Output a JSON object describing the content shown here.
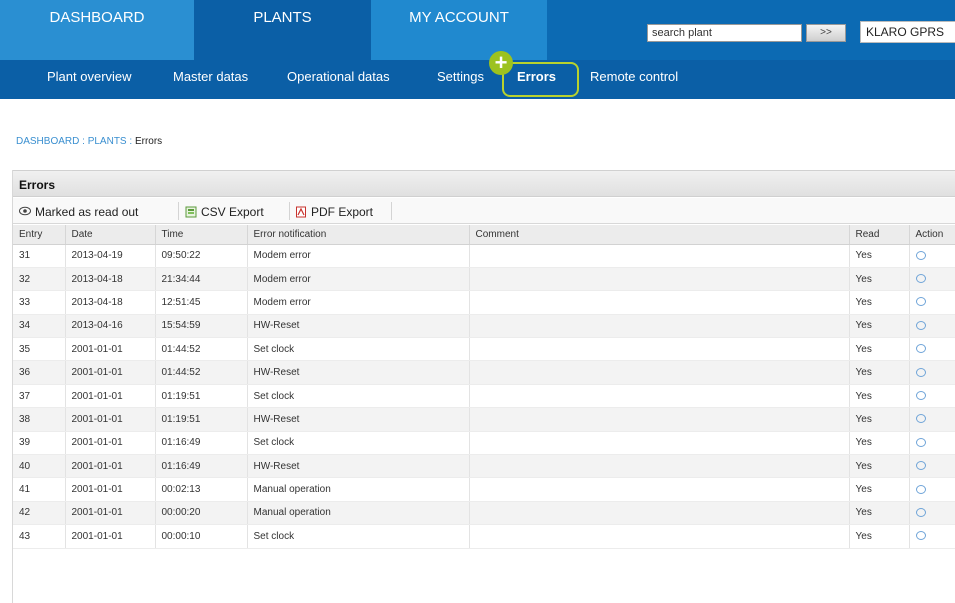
{
  "topnav": {
    "dashboard": "DASHBOARD",
    "plants": "PLANTS",
    "my_account": "MY ACCOUNT",
    "search_value": "search plant",
    "search_button": ">>",
    "account_name": "KLARO GPRS"
  },
  "subnav": {
    "plant_overview": "Plant overview",
    "master_datas": "Master datas",
    "operational_datas": "Operational datas",
    "settings": "Settings",
    "errors": "Errors",
    "remote_control": "Remote control",
    "plus": "+"
  },
  "breadcrumb": {
    "dashboard": "DASHBOARD",
    "plants": "PLANTS",
    "separator": ":",
    "current": "Errors"
  },
  "panel": {
    "title": "Errors",
    "toolbar": {
      "marked_read": "Marked as read out",
      "csv_export": "CSV Export",
      "pdf_export": "PDF Export"
    }
  },
  "table": {
    "headers": {
      "entry": "Entry",
      "date": "Date",
      "time": "Time",
      "notification": "Error notification",
      "comment": "Comment",
      "read": "Read",
      "action": "Action"
    },
    "rows": [
      {
        "entry": "31",
        "date": "2013-04-19",
        "time": "09:50:22",
        "notification": "Modem error",
        "comment": "",
        "read": "Yes"
      },
      {
        "entry": "32",
        "date": "2013-04-18",
        "time": "21:34:44",
        "notification": "Modem error",
        "comment": "",
        "read": "Yes"
      },
      {
        "entry": "33",
        "date": "2013-04-18",
        "time": "12:51:45",
        "notification": "Modem error",
        "comment": "",
        "read": "Yes"
      },
      {
        "entry": "34",
        "date": "2013-04-16",
        "time": "15:54:59",
        "notification": "HW-Reset",
        "comment": "",
        "read": "Yes"
      },
      {
        "entry": "35",
        "date": "2001-01-01",
        "time": "01:44:52",
        "notification": "Set clock",
        "comment": "",
        "read": "Yes"
      },
      {
        "entry": "36",
        "date": "2001-01-01",
        "time": "01:44:52",
        "notification": "HW-Reset",
        "comment": "",
        "read": "Yes"
      },
      {
        "entry": "37",
        "date": "2001-01-01",
        "time": "01:19:51",
        "notification": "Set clock",
        "comment": "",
        "read": "Yes"
      },
      {
        "entry": "38",
        "date": "2001-01-01",
        "time": "01:19:51",
        "notification": "HW-Reset",
        "comment": "",
        "read": "Yes"
      },
      {
        "entry": "39",
        "date": "2001-01-01",
        "time": "01:16:49",
        "notification": "Set clock",
        "comment": "",
        "read": "Yes"
      },
      {
        "entry": "40",
        "date": "2001-01-01",
        "time": "01:16:49",
        "notification": "HW-Reset",
        "comment": "",
        "read": "Yes"
      },
      {
        "entry": "41",
        "date": "2001-01-01",
        "time": "00:02:13",
        "notification": "Manual operation",
        "comment": "",
        "read": "Yes"
      },
      {
        "entry": "42",
        "date": "2001-01-01",
        "time": "00:00:20",
        "notification": "Manual operation",
        "comment": "",
        "read": "Yes"
      },
      {
        "entry": "43",
        "date": "2001-01-01",
        "time": "00:00:10",
        "notification": "Set clock",
        "comment": "",
        "read": "Yes"
      }
    ]
  },
  "colors": {
    "nav_blue": "#1a7fc5",
    "subnav_blue": "#0b5fa6",
    "highlight_green": "#9cc21f",
    "link_blue": "#3a8fd0"
  },
  "icons": {
    "marked_read": "eye-icon",
    "csv_export": "csv-file-icon",
    "pdf_export": "pdf-file-icon",
    "row_action": "comment-bubble-icon",
    "plus": "plus-badge-icon"
  }
}
